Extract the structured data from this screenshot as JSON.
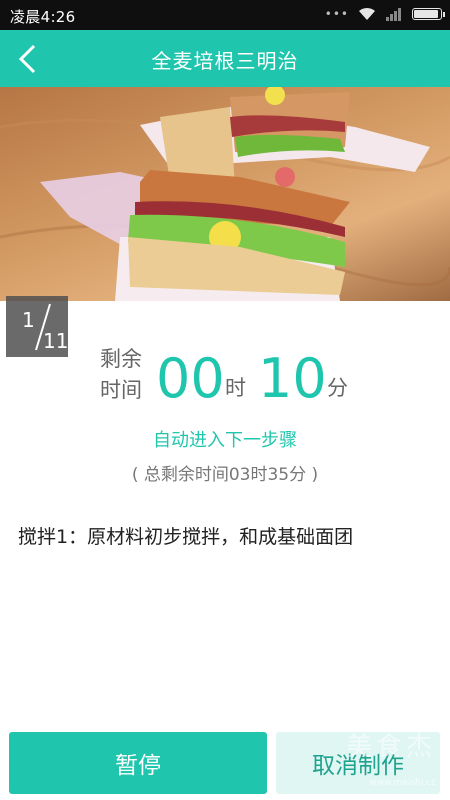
{
  "status": {
    "time": "凌晨4:26"
  },
  "header": {
    "title": "全麦培根三明治"
  },
  "hero": {
    "step_current": "1",
    "step_total": "11"
  },
  "timer": {
    "remain_label": "剩余\n时间",
    "hours": "00",
    "hours_unit": "时",
    "minutes": "10",
    "minutes_unit": "分",
    "auto_next": "自动进入下一步骤",
    "total_remaining": "( 总剩余时间03时35分 )"
  },
  "step": {
    "description": "搅拌1：原材料初步搅拌，和成基础面团"
  },
  "buttons": {
    "pause": "暂停",
    "cancel": "取消制作"
  },
  "watermark": {
    "cn": "美食杰",
    "en": "www.meishi.cc"
  },
  "colors": {
    "accent": "#1fc6ad",
    "status_bar": "#0f0f0f"
  },
  "icons": {
    "back": "chevron-left-icon",
    "wifi": "wifi-icon",
    "signal": "signal-icon",
    "battery": "battery-icon"
  }
}
